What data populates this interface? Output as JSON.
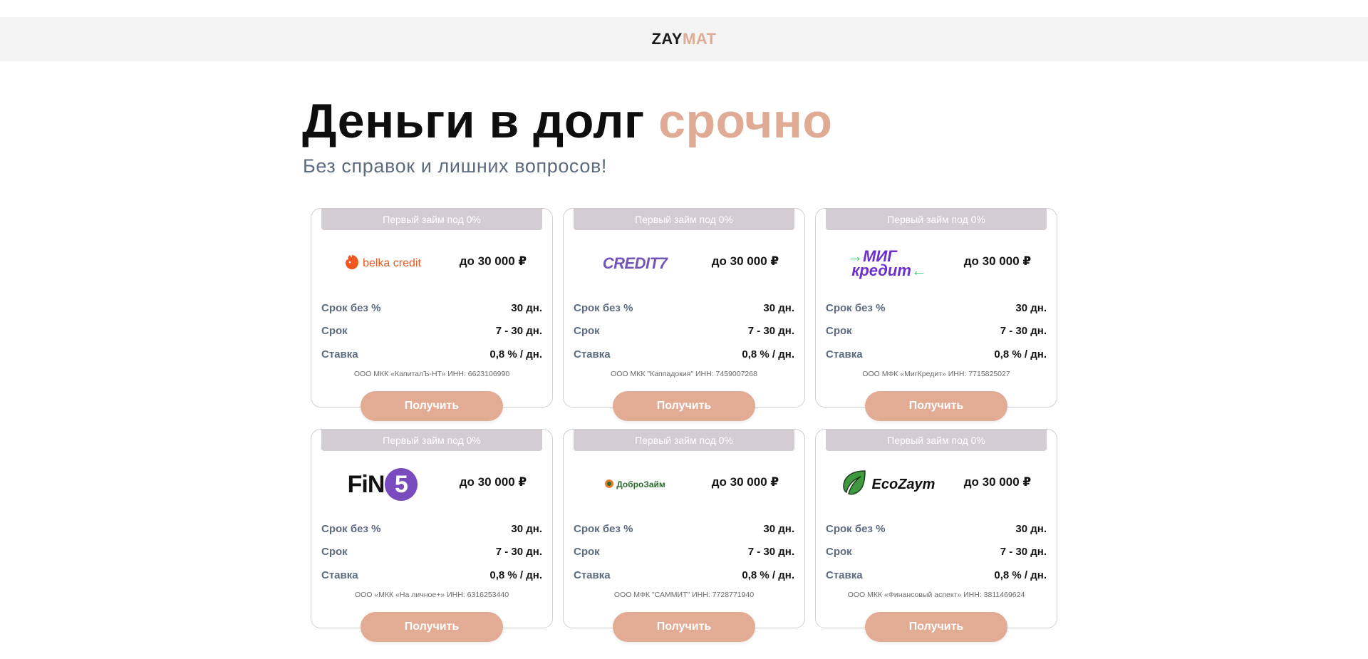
{
  "header": {
    "logo_part1": "ZAY",
    "logo_part2": "MAT"
  },
  "hero": {
    "title_main": "Деньги в долг",
    "title_accent": "срочно",
    "subtitle": "Без справок и лишних вопросов!"
  },
  "colors": {
    "accent": "#e0ab95",
    "button": "#e2ab94",
    "promo_bg": "#d3ccd3",
    "label_text": "#5d6b80"
  },
  "offers": [
    {
      "promo": "Первый займ под 0%",
      "logo_text": "belka credit",
      "logo_icon": "squirrel-icon",
      "amount": "до 30 000 ₽",
      "free_term_label": "Срок без %",
      "free_term_value": "30 дн.",
      "term_label": "Срок",
      "term_value": "7 - 30 дн.",
      "rate_label": "Ставка",
      "rate_value": "0,8 % / дн.",
      "legal": "ООО МКК «КапиталЪ-НТ» ИНН: 6623106990",
      "button": "Получить"
    },
    {
      "promo": "Первый займ под 0%",
      "logo_text": "CREDIT7",
      "amount": "до 30 000 ₽",
      "free_term_label": "Срок без %",
      "free_term_value": "30 дн.",
      "term_label": "Срок",
      "term_value": "7 - 30 дн.",
      "rate_label": "Ставка",
      "rate_value": "0,8 % / дн.",
      "legal": "ООО МКК \"Каппадокия\" ИНН: 7459007268",
      "button": "Получить"
    },
    {
      "promo": "Первый займ под 0%",
      "logo_line1": "МИГ",
      "logo_line2": "кредит",
      "amount": "до 30 000 ₽",
      "free_term_label": "Срок без %",
      "free_term_value": "30 дн.",
      "term_label": "Срок",
      "term_value": "7 - 30 дн.",
      "rate_label": "Ставка",
      "rate_value": "0,8 % / дн.",
      "legal": "ООО МФК «МигКредит» ИНН: 7715825027",
      "button": "Получить"
    },
    {
      "promo": "Первый займ под 0%",
      "logo_text": "FiN",
      "logo_digit": "5",
      "amount": "до 30 000 ₽",
      "free_term_label": "Срок без %",
      "free_term_value": "30 дн.",
      "term_label": "Срок",
      "term_value": "7 - 30 дн.",
      "rate_label": "Ставка",
      "rate_value": "0,8 % / дн.",
      "legal": "ООО «МКК «На личное+» ИНН: 6316253440",
      "button": "Получить"
    },
    {
      "promo": "Первый займ под 0%",
      "logo_text": "ДоброЗайм",
      "amount": "до 30 000 ₽",
      "free_term_label": "Срок без %",
      "free_term_value": "30 дн.",
      "term_label": "Срок",
      "term_value": "7 - 30 дн.",
      "rate_label": "Ставка",
      "rate_value": "0,8 % / дн.",
      "legal": "ООО МФК \"САММИТ\" ИНН: 7728771940",
      "button": "Получить"
    },
    {
      "promo": "Первый займ под 0%",
      "logo_text": "EcoZaym",
      "logo_icon": "leaf-icon",
      "amount": "до 30 000 ₽",
      "free_term_label": "Срок без %",
      "free_term_value": "30 дн.",
      "term_label": "Срок",
      "term_value": "7 - 30 дн.",
      "rate_label": "Ставка",
      "rate_value": "0,8 % / дн.",
      "legal": "ООО МКК «Финансовый аспект» ИНН: 3811469624",
      "button": "Получить"
    }
  ]
}
